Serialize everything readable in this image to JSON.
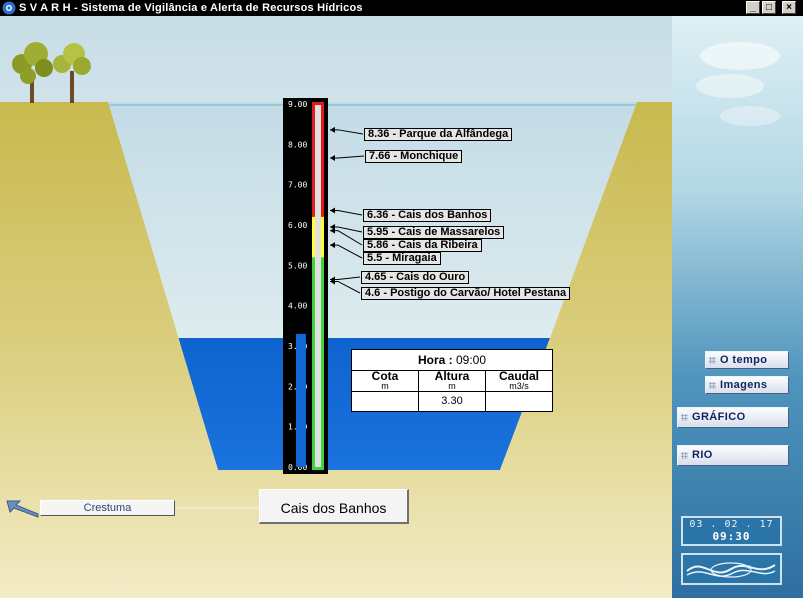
{
  "window": {
    "title": "S V A R H  -  Sistema de Vigilância e Alerta de Recursos Hídricos",
    "controls": [
      "_",
      "□",
      "×"
    ]
  },
  "gauge": {
    "ticks": [
      "9.00",
      "8.00",
      "7.00",
      "6.00",
      "5.00",
      "4.00",
      "3.00",
      "2.00",
      "1.00",
      "0.00"
    ],
    "current_level": 3.3,
    "max": 9,
    "zones": {
      "green": "#3fd43f",
      "yellow": "#ffff33",
      "red": "#e21a1a"
    }
  },
  "stations": [
    {
      "label": "8.36 - Parque da Alfândega",
      "level": 8.36
    },
    {
      "label": "7.66 - Monchique",
      "level": 7.66
    },
    {
      "label": "6.36 - Cais dos Banhos",
      "level": 6.36
    },
    {
      "label": "5.95 - Cais de Massarelos",
      "level": 5.95
    },
    {
      "label": "5.86 - Cais da Ribeira",
      "level": 5.86
    },
    {
      "label": "5.5 - Miragaia",
      "level": 5.5
    },
    {
      "label": "4.65 - Cais do Ouro",
      "level": 4.65
    },
    {
      "label": "4.6 - Postigo do Carvão/ Hotel Pestana",
      "level": 4.6
    }
  ],
  "info": {
    "hora_label": "Hora :",
    "hora_value": "09:00",
    "columns": [
      {
        "title": "Cota",
        "unit": "m",
        "value": ""
      },
      {
        "title": "Altura",
        "unit": "m",
        "value": "3.30"
      },
      {
        "title": "Caudal",
        "unit": "m3/s",
        "value": ""
      }
    ]
  },
  "location": {
    "current_station": "Cais  dos Banhos",
    "upstream_station": "Crestuma"
  },
  "sidebar": {
    "buttons": [
      {
        "label": "O tempo"
      },
      {
        "label": "Imagens"
      },
      {
        "label": "GRÁFICO"
      },
      {
        "label": "RIO"
      }
    ],
    "date": "03 . 02 . 17",
    "time": "09:30"
  },
  "colors": {
    "water": "#1167d3",
    "bank": "#cfc062",
    "sky_line": "#6cb7d8"
  }
}
